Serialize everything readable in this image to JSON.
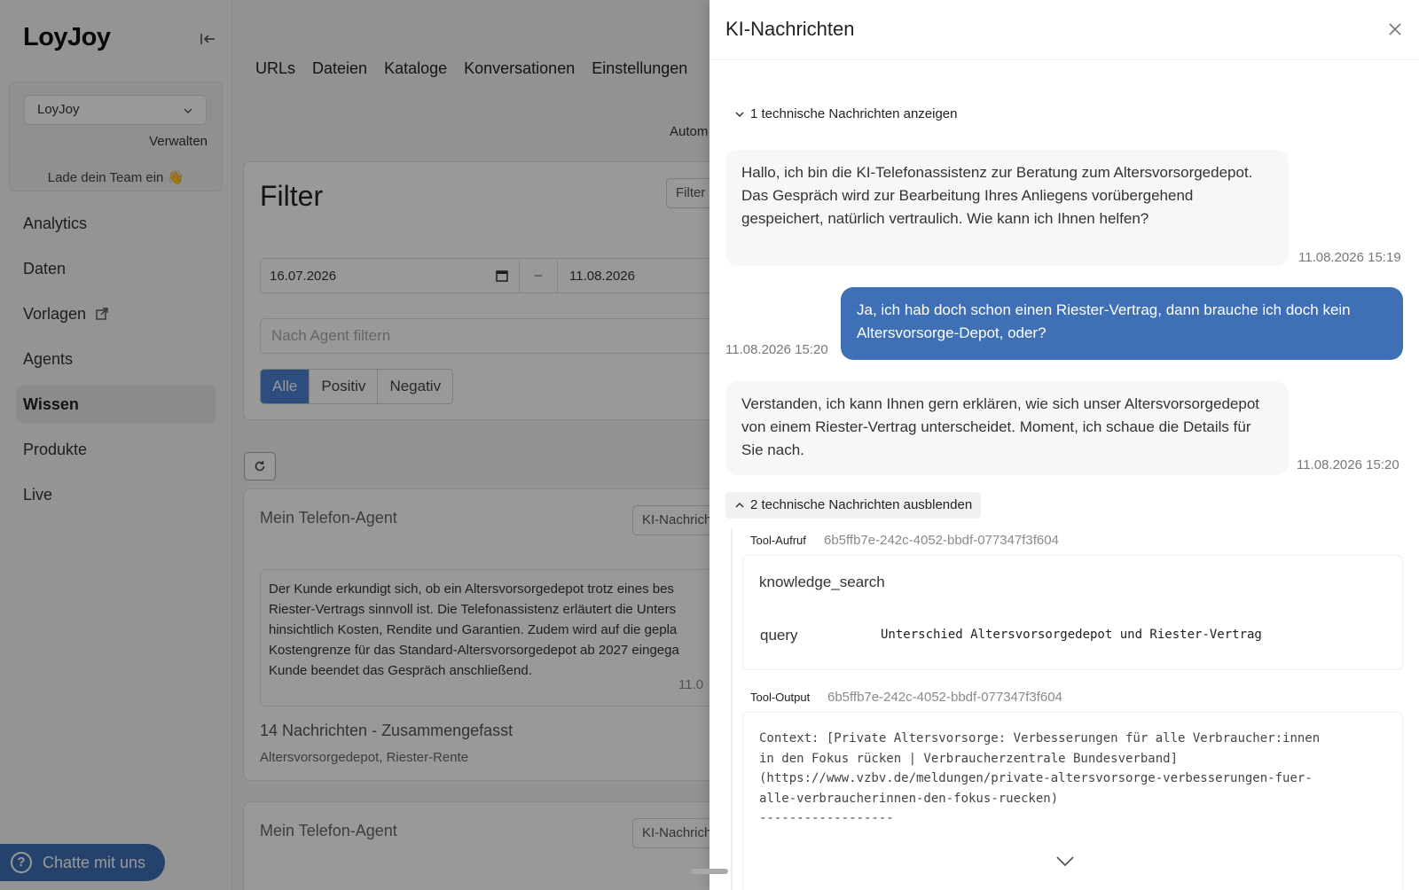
{
  "brand": {
    "logo": "LoyJoy"
  },
  "sidebar": {
    "team_select": "LoyJoy",
    "manage": "Verwalten",
    "invite": "Lade dein Team ein 👋",
    "items": [
      {
        "label": "Analytics"
      },
      {
        "label": "Daten"
      },
      {
        "label": "Vorlagen"
      },
      {
        "label": "Agents"
      },
      {
        "label": "Wissen"
      },
      {
        "label": "Produkte"
      },
      {
        "label": "Live"
      }
    ],
    "chat_button": "Chatte mit uns"
  },
  "topnav": {
    "tabs": [
      "URLs",
      "Dateien",
      "Kataloge",
      "Konversationen",
      "Einstellungen"
    ]
  },
  "auto_label": "Autom",
  "filter": {
    "title": "Filter",
    "button": "Filter",
    "date_from": "16.07.2026",
    "date_sep": "–",
    "date_to": "11.08.2026",
    "agent_placeholder": "Nach Agent filtern",
    "segments": [
      "Alle",
      "Positiv",
      "Negativ"
    ]
  },
  "conversations": [
    {
      "agent": "Mein Telefon-Agent",
      "ki_button": "KI-Nachrich",
      "summary": "Der Kunde erkundigt sich, ob ein Altersvorsorgedepot trotz eines bes\nRiester-Vertrags sinnvoll ist. Die Telefonassistenz erläutert die Unters\nhinsichtlich Kosten, Rendite und Garantien. Zudem wird auf die gepla\nKostengrenze für das Standard-Altersvorsorgedepot ab 2027 eingega\nKunde beendet das Gespräch anschließend.",
      "date": "11.0",
      "count": "14 Nachrichten - Zusammengefasst",
      "tags": "Altersvorsorgedepot, Riester-Rente"
    },
    {
      "agent": "Mein Telefon-Agent",
      "ki_button": "KI-Nachrich"
    }
  ],
  "drawer": {
    "title": "KI-Nachrichten",
    "toggle_show": "1 technische Nachrichten anzeigen",
    "messages": [
      {
        "text": "Hallo, ich bin die KI-Telefonassistenz zur Beratung zum Altersvorsorgedepot. Das Gespräch wird zur Bearbeitung Ihres Anliegens vorübergehend gespeichert, natürlich vertraulich. Wie kann ich Ihnen helfen?",
        "time": "11.08.2026 15:19"
      },
      {
        "text": "Ja, ich hab doch schon einen Riester-Vertrag, dann brauche ich doch kein Altersvorsorge-Depot, oder?",
        "time": "11.08.2026 15:20"
      },
      {
        "text": "Verstanden, ich kann Ihnen gern erklären, wie sich unser Altersvorsorgedepot von einem Riester-Vertrag unterscheidet. Moment, ich schaue die Details für Sie nach.",
        "time": "11.08.2026 15:20"
      }
    ],
    "toggle_hide": "2 technische Nachrichten ausblenden",
    "tool_call": {
      "label": "Tool-Aufruf",
      "id": "6b5ffb7e-242c-4052-bbdf-077347f3f604",
      "name": "knowledge_search",
      "param_key": "query",
      "param_value": "Unterschied Altersvorsorgedepot und Riester-Vertrag"
    },
    "tool_output": {
      "label": "Tool-Output",
      "id": "6b5ffb7e-242c-4052-bbdf-077347f3f604",
      "text": "Context: [Private Altersvorsorge: Verbesserungen für alle Verbraucher:innen\nin den Fokus rücken | Verbraucherzentrale Bundesverband]\n(https://www.vzbv.de/meldungen/private-altersvorsorge-verbesserungen-fuer-\nalle-verbraucherinnen-den-fokus-ruecken)\n------------------"
    }
  }
}
